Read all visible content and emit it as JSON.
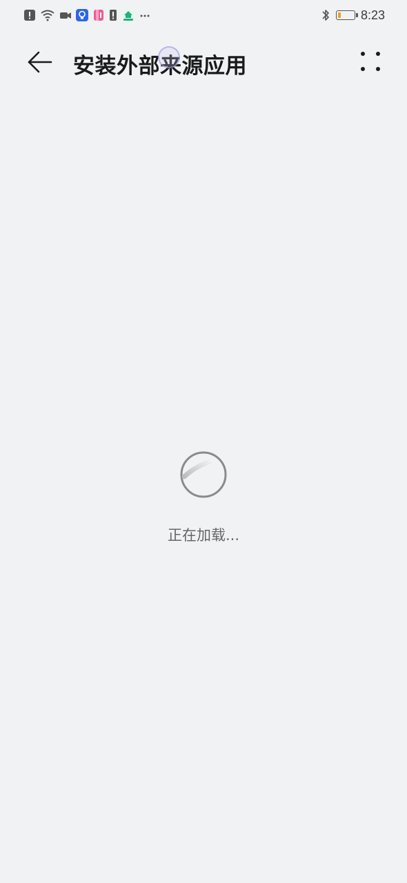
{
  "status_bar": {
    "time": "8:23",
    "left_icons": [
      "alert-icon",
      "wifi-icon",
      "video-icon",
      "bulb-app-icon",
      "pink-app-icon",
      "alert-icon",
      "home-app-icon",
      "more-notifications-icon"
    ],
    "right_icons": [
      "bluetooth-icon",
      "battery-icon"
    ],
    "battery_level_fraction": 0.2,
    "colors": {
      "battery_fill": "#f0a020",
      "bulb_app": "#2f66e6",
      "home_app": "#22b07d"
    }
  },
  "header": {
    "title": "安装外部来源应用",
    "back_icon": "back-arrow-icon",
    "more_icon": "more-vertical-icon"
  },
  "loading": {
    "text": "正在加载..."
  },
  "colors": {
    "background": "#f1f2f4",
    "title": "#1a1a1a",
    "loading_text": "#666666"
  }
}
